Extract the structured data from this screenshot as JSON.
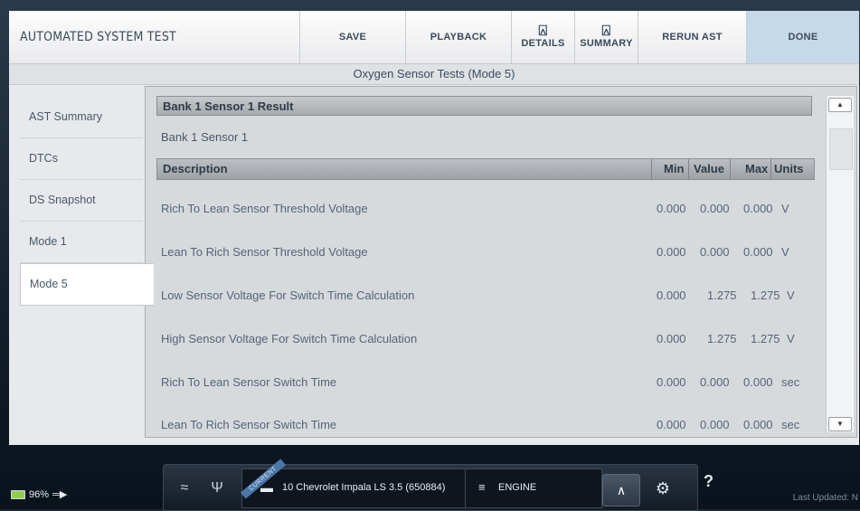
{
  "header": {
    "title": "AUTOMATED SYSTEM TEST",
    "buttons": {
      "save": "SAVE",
      "playback": "PLAYBACK",
      "details": "DETAILS",
      "summary": "SUMMARY",
      "rerun": "RERUN AST",
      "done": "DONE"
    }
  },
  "subheader": "Oxygen Sensor Tests (Mode 5)",
  "nav": {
    "items": [
      {
        "label": "AST Summary"
      },
      {
        "label": "DTCs"
      },
      {
        "label": "DS Snapshot"
      },
      {
        "label": "Mode 1"
      },
      {
        "label": "Mode 5"
      }
    ],
    "active_index": 4
  },
  "panel": {
    "result_title": "Bank 1 Sensor 1 Result",
    "sensor_name": "Bank 1 Sensor 1",
    "columns": {
      "description": "Description",
      "min": "Min",
      "value": "Value",
      "max": "Max",
      "units": "Units"
    },
    "rows": [
      {
        "description": "Rich To Lean Sensor Threshold Voltage",
        "min": "0.000",
        "value": "0.000",
        "max": "0.000",
        "units": "V"
      },
      {
        "description": "Lean To Rich Sensor Threshold Voltage",
        "min": "0.000",
        "value": "0.000",
        "max": "0.000",
        "units": "V"
      },
      {
        "description": "Low Sensor Voltage For Switch Time Calculation",
        "min": "0.000",
        "value": "1.275",
        "max": "1.275",
        "units": "V"
      },
      {
        "description": "High Sensor Voltage For Switch Time Calculation",
        "min": "0.000",
        "value": "1.275",
        "max": "1.275",
        "units": "V"
      },
      {
        "description": "Rich To Lean Sensor Switch Time",
        "min": "0.000",
        "value": "0.000",
        "max": "0.000",
        "units": "sec"
      },
      {
        "description": "Lean To Rich Sensor Switch Time",
        "min": "0.000",
        "value": "0.000",
        "max": "0.000",
        "units": "sec"
      }
    ]
  },
  "dock": {
    "vehicle": "10 Chevrolet Impala LS 3.5 (650884)",
    "badge": "CURRENT",
    "engine": "ENGINE"
  },
  "status": {
    "battery": "96%",
    "last_updated": "Last Updated: N"
  },
  "colors": {
    "done_bg": "#c6d9ea",
    "battery_green": "#8fd14f"
  }
}
